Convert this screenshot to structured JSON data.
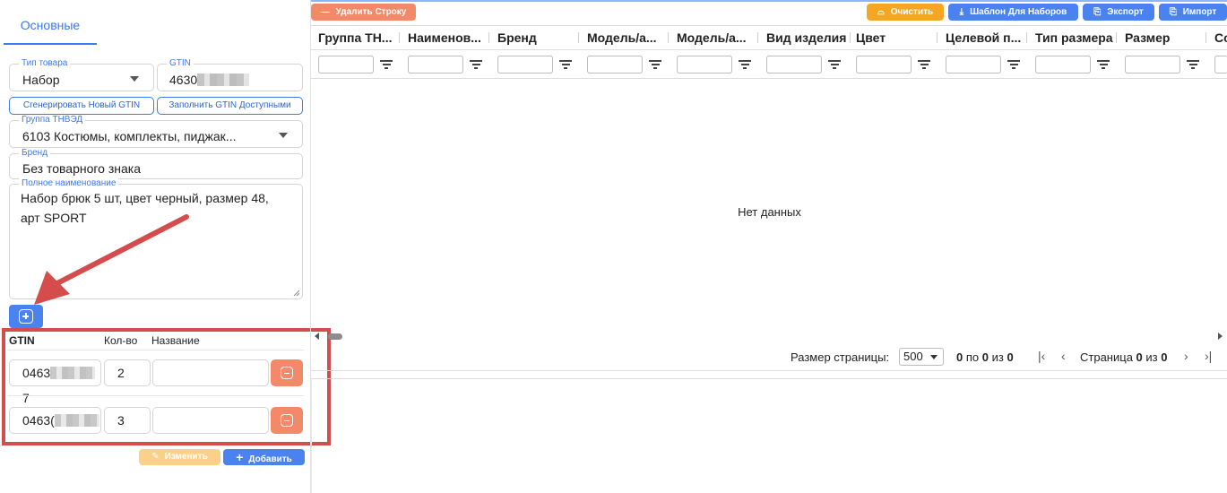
{
  "left": {
    "tab_main": "Основные",
    "product_type": {
      "label": "Тип товара",
      "value": "Набор"
    },
    "gtin": {
      "label": "GTIN",
      "value": "4630"
    },
    "btn_generate": "Сгенерировать Новый GTIN",
    "btn_fill": "Заполнить GTIN Доступными",
    "tnved": {
      "label": "Группа ТНВЭД",
      "value": "6103 Костюмы, комплекты, пиджак..."
    },
    "brand": {
      "label": "Бренд",
      "value": "Без товарного знака"
    },
    "fullname": {
      "label": "Полное наименование",
      "line1": "Набор брюк 5 шт, цвет черный, размер 48,",
      "line2": "арт SPORT"
    },
    "set_table": {
      "headers": {
        "gtin": "GTIN",
        "qty": "Кол-во",
        "name": "Название"
      },
      "rows": [
        {
          "gtin_prefix": "0463",
          "gtin_suffix": "7",
          "qty": "2",
          "name": ""
        },
        {
          "gtin_prefix": "0463(",
          "gtin_suffix": "",
          "qty": "3",
          "name": ""
        }
      ]
    },
    "btn_edit": "Изменить",
    "btn_add": "Добавить"
  },
  "right": {
    "toolbar": {
      "delete_row": "Удалить Строку",
      "clear": "Очистить",
      "template": "Шаблон Для Наборов",
      "export": "Экспорт",
      "import": "Импорт"
    },
    "columns": [
      "Группа ТН...",
      "Наименов...",
      "Бренд",
      "Модель/а...",
      "Модель/а...",
      "Вид изделия",
      "Цвет",
      "Целевой п...",
      "Тип размера",
      "Размер",
      "Со"
    ],
    "empty_text": "Нет данных",
    "pager": {
      "page_size_label": "Размер страницы:",
      "page_size": "500",
      "from": "0",
      "to_word": "по",
      "to": "0",
      "of_word": "из",
      "total": "0",
      "page_word": "Страница",
      "page": "0",
      "pages_of_word": "из",
      "pages": "0"
    }
  },
  "colors": {
    "accent": "#3a7bef",
    "danger": "#f4896a",
    "warning": "#f5a623",
    "highlight": "#d54c4c"
  }
}
